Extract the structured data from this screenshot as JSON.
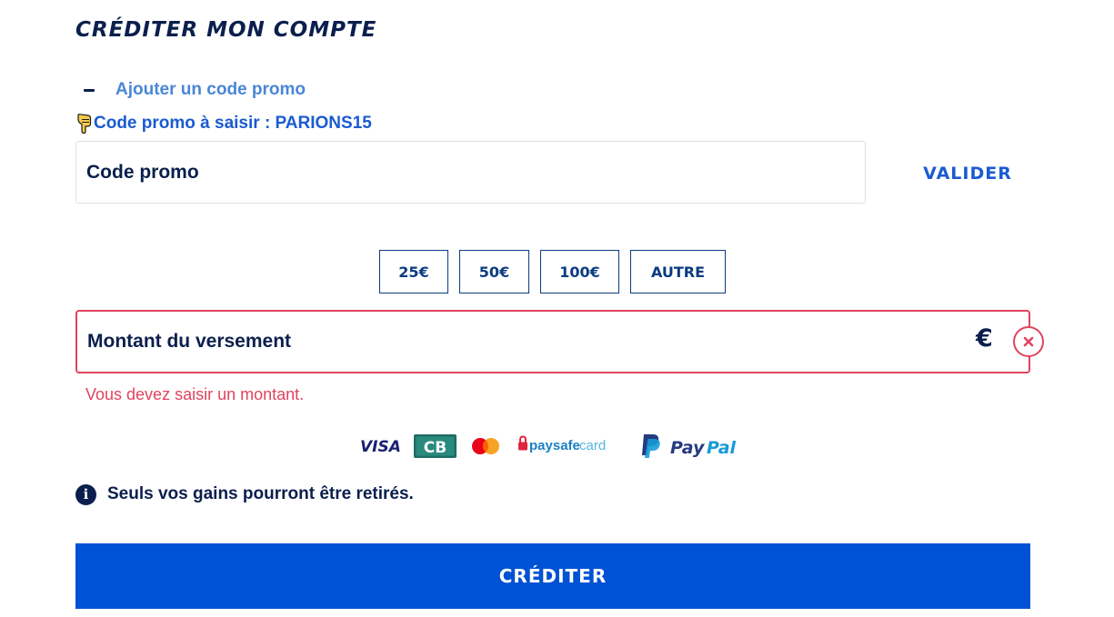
{
  "page": {
    "title": "CRÉDITER MON COMPTE"
  },
  "promo": {
    "toggle_label": "Ajouter un code promo",
    "hint": "Code promo à saisir : PARIONS15",
    "input_placeholder": "Code promo",
    "input_value": "",
    "validate_label": "VALIDER"
  },
  "amounts": {
    "options": [
      "25€",
      "50€",
      "100€",
      "AUTRE"
    ]
  },
  "deposit": {
    "placeholder": "Montant du versement",
    "value": "",
    "currency": "€",
    "error": "Vous devez saisir un montant."
  },
  "payment_methods": [
    "VISA",
    "CB",
    "Mastercard",
    "paysafecard",
    "PayPal"
  ],
  "info": {
    "text": "Seuls vos gains pourront être retirés.",
    "icon": "info-icon"
  },
  "submit": {
    "label": "CRÉDITER"
  },
  "colors": {
    "navy": "#0b1f4d",
    "primary": "#0052d4",
    "link": "#1a5bd1",
    "error": "#e0445f"
  }
}
